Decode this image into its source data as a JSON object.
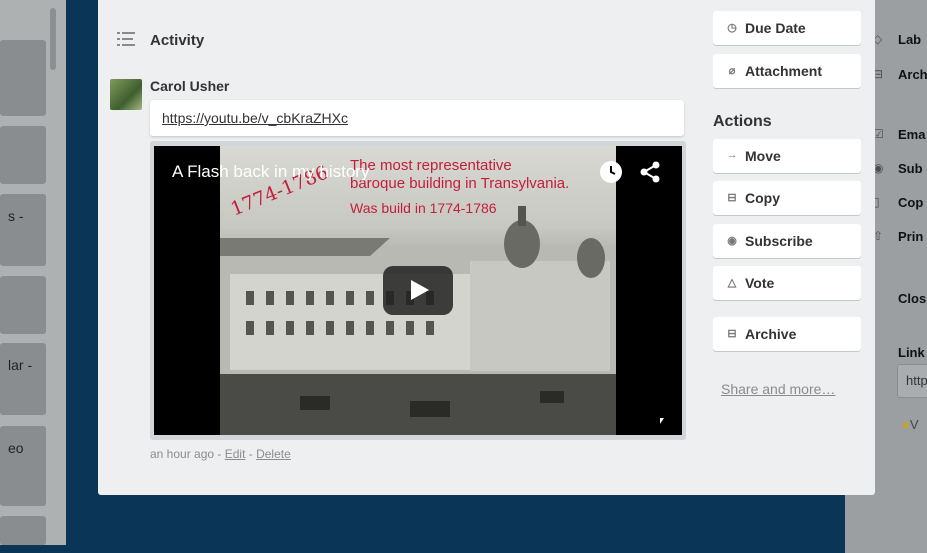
{
  "background": {
    "left_cards": [
      "s -",
      "lar -",
      "eo"
    ],
    "right_items": [
      "Lab",
      "Arch",
      "Ema",
      "Sub",
      "Cop",
      "Prin",
      "Clos",
      "Link"
    ],
    "right_field_value": "http",
    "right_footer": "V"
  },
  "activity": {
    "title": "Activity",
    "comment": {
      "author": "Carol Usher",
      "link_text": "https://youtu.be/v_cbKraZHXc",
      "timestamp": "an hour ago",
      "separator": " - ",
      "edit_label": "Edit",
      "delete_label": "Delete"
    },
    "video": {
      "title": "A Flash back in my history",
      "caption_line1": "The most representative",
      "caption_line2": "baroque building in Transylvania.",
      "caption_line3": "Was build in 1774-1786",
      "year_overlay": "1774-1786"
    }
  },
  "sidebar": {
    "due_date_label": "Due Date",
    "attachment_label": "Attachment",
    "actions_heading": "Actions",
    "move_label": "Move",
    "copy_label": "Copy",
    "subscribe_label": "Subscribe",
    "vote_label": "Vote",
    "archive_label": "Archive",
    "share_label": "Share and more…"
  },
  "colors": {
    "board_bg": "#0b3556",
    "modal_bg": "#edeff0",
    "overlay_red": "#c41e3a"
  }
}
